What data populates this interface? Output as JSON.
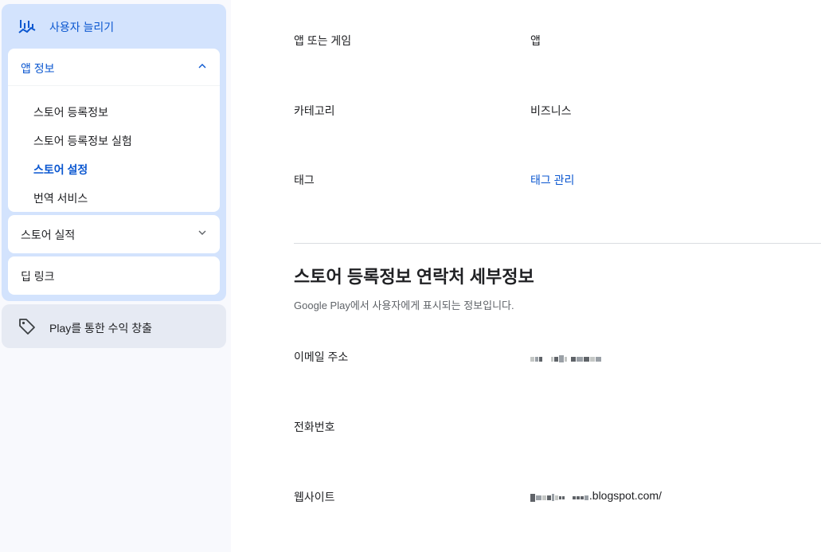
{
  "sidebar": {
    "grow_users": {
      "label": "사용자 늘리기",
      "icon": "trending-chart-icon"
    },
    "app_info": {
      "title": "앱 정보",
      "expanded": true,
      "items": [
        {
          "label": "스토어 등록정보"
        },
        {
          "label": "스토어 등록정보 실험"
        },
        {
          "label": "스토어 설정",
          "active": true
        },
        {
          "label": "번역 서비스"
        }
      ]
    },
    "store_performance": {
      "title": "스토어 실적"
    },
    "deep_links": {
      "title": "딥 링크"
    },
    "monetize": {
      "label": "Play를 통한 수익 창출",
      "icon": "tag-icon"
    }
  },
  "main": {
    "app_or_game": {
      "label": "앱 또는 게임",
      "value": "앱"
    },
    "category": {
      "label": "카테고리",
      "value": "비즈니스"
    },
    "tags": {
      "label": "태그",
      "value": "태그 관리"
    },
    "contact_section": {
      "title": "스토어 등록정보 연락처 세부정보",
      "description": "Google Play에서 사용자에게 표시되는 정보입니다.",
      "email": {
        "label": "이메일 주소"
      },
      "phone": {
        "label": "전화번호"
      },
      "website": {
        "label": "웹사이트",
        "value_suffix": ".blogspot.com/"
      }
    }
  },
  "colors": {
    "accent": "#0b57d0",
    "sidebar_group": "#d3e3fd",
    "sidebar_bg": "#f8f9fd"
  }
}
